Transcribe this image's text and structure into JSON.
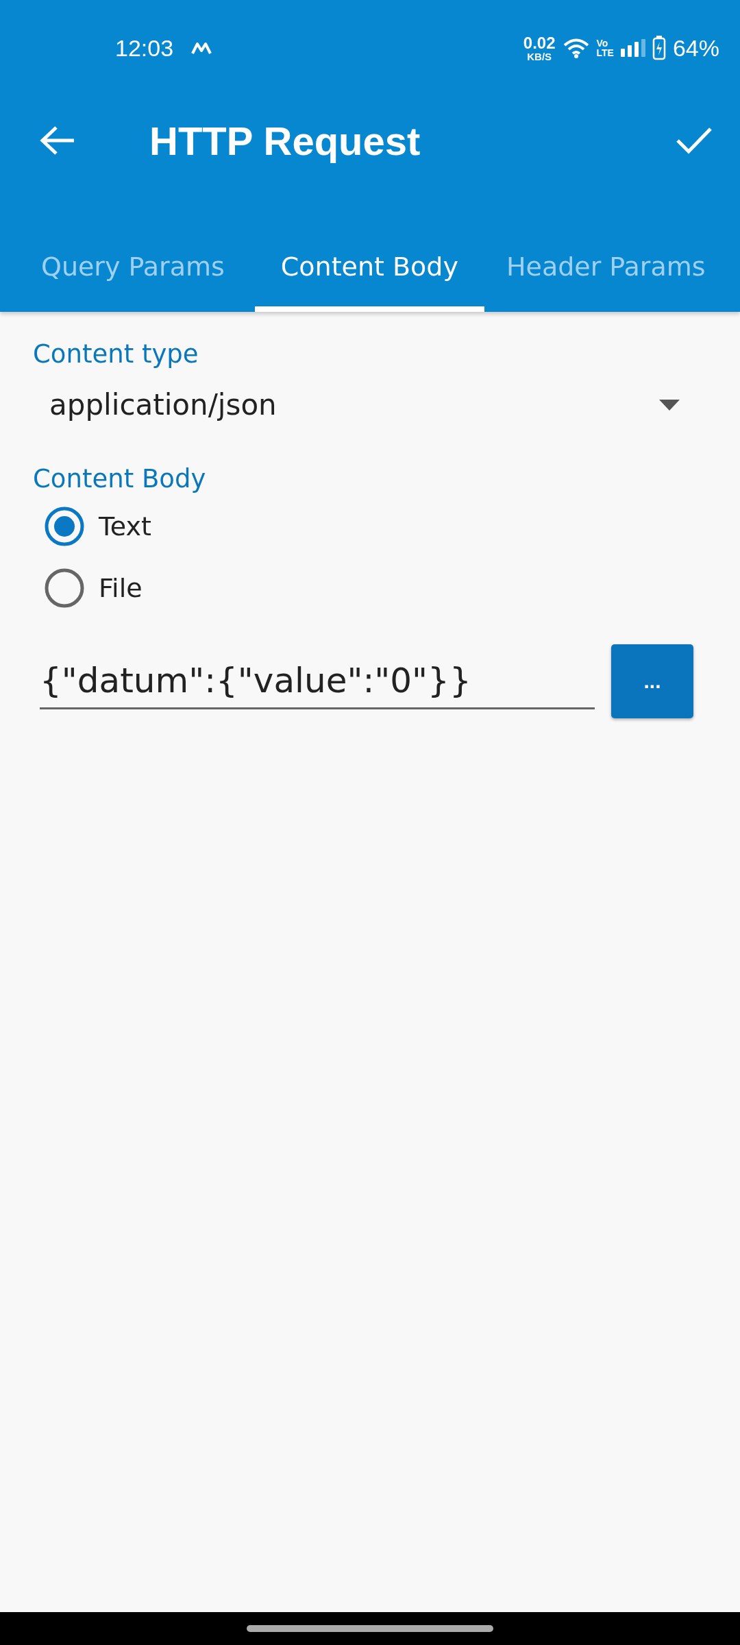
{
  "status_bar": {
    "time": "12:03",
    "net_speed": "0.02",
    "net_unit": "KB/S",
    "volte_top": "Vo",
    "volte_bottom": "LTE",
    "battery": "64%"
  },
  "app_bar": {
    "title": "HTTP Request"
  },
  "tabs": [
    {
      "label": "Query Params",
      "selected": false
    },
    {
      "label": "Content Body",
      "selected": true
    },
    {
      "label": "Header Params",
      "selected": false
    }
  ],
  "content_type": {
    "label": "Content type",
    "value": "application/json"
  },
  "content_body": {
    "label": "Content Body",
    "options": [
      {
        "label": "Text",
        "selected": true
      },
      {
        "label": "File",
        "selected": false
      }
    ],
    "value": "{\"datum\":{\"value\":\"0\"}}",
    "button": "..."
  }
}
